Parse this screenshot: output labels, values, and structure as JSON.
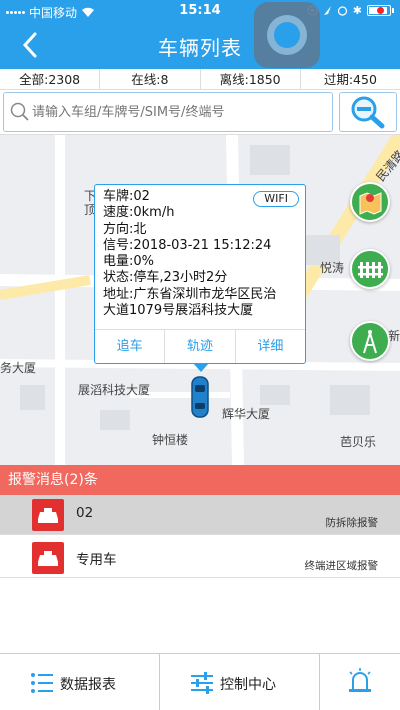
{
  "status_bar": {
    "carrier": "中国移动",
    "time": "15:14"
  },
  "header": {
    "title": "车辆列表",
    "back_icon": "chevron-left-icon"
  },
  "stats": [
    {
      "label": "全部:2308"
    },
    {
      "label": "在线:8"
    },
    {
      "label": "离线:1850"
    },
    {
      "label": "过期:450"
    }
  ],
  "search": {
    "placeholder": "请输入车组/车牌号/SIM号/终端号"
  },
  "map": {
    "labels": {
      "road_top_right": "民清路",
      "pois_north": "悦涛",
      "building_xin": "新",
      "building_zhanzhao": "展滔科技大厦",
      "building_huihua": "辉华大厦",
      "building_zhongheng": "钟恒楼",
      "poi_babeile": "芭贝乐",
      "building_wu": "务大厦",
      "road_left_a": "下",
      "road_left_b": "顶"
    },
    "popup": {
      "wifi_badge": "WIFI",
      "lines": [
        "车牌:02",
        "速度:0km/h",
        "方向:北",
        "信号:2018-03-21 15:12:24",
        "电量:0%",
        "状态:停车,23小时2分",
        "地址:广东省深圳市龙华区民治",
        "大道1079号展滔科技大厦"
      ],
      "actions": [
        "追车",
        "轨迹",
        "详细"
      ]
    }
  },
  "alarms": {
    "header": "报警消息(2)条",
    "items": [
      {
        "name": "02",
        "type": "防拆除报警"
      },
      {
        "name": "专用车",
        "type": "终端进区域报警"
      }
    ]
  },
  "bottom_nav": [
    {
      "label": "数据报表"
    },
    {
      "label": "控制中心"
    },
    {
      "label": ""
    }
  ],
  "colors": {
    "primary": "#2aa0ea",
    "alarm": "#f1685f",
    "car_icon": "#e22f2f",
    "map_button": "#3dad4f"
  }
}
